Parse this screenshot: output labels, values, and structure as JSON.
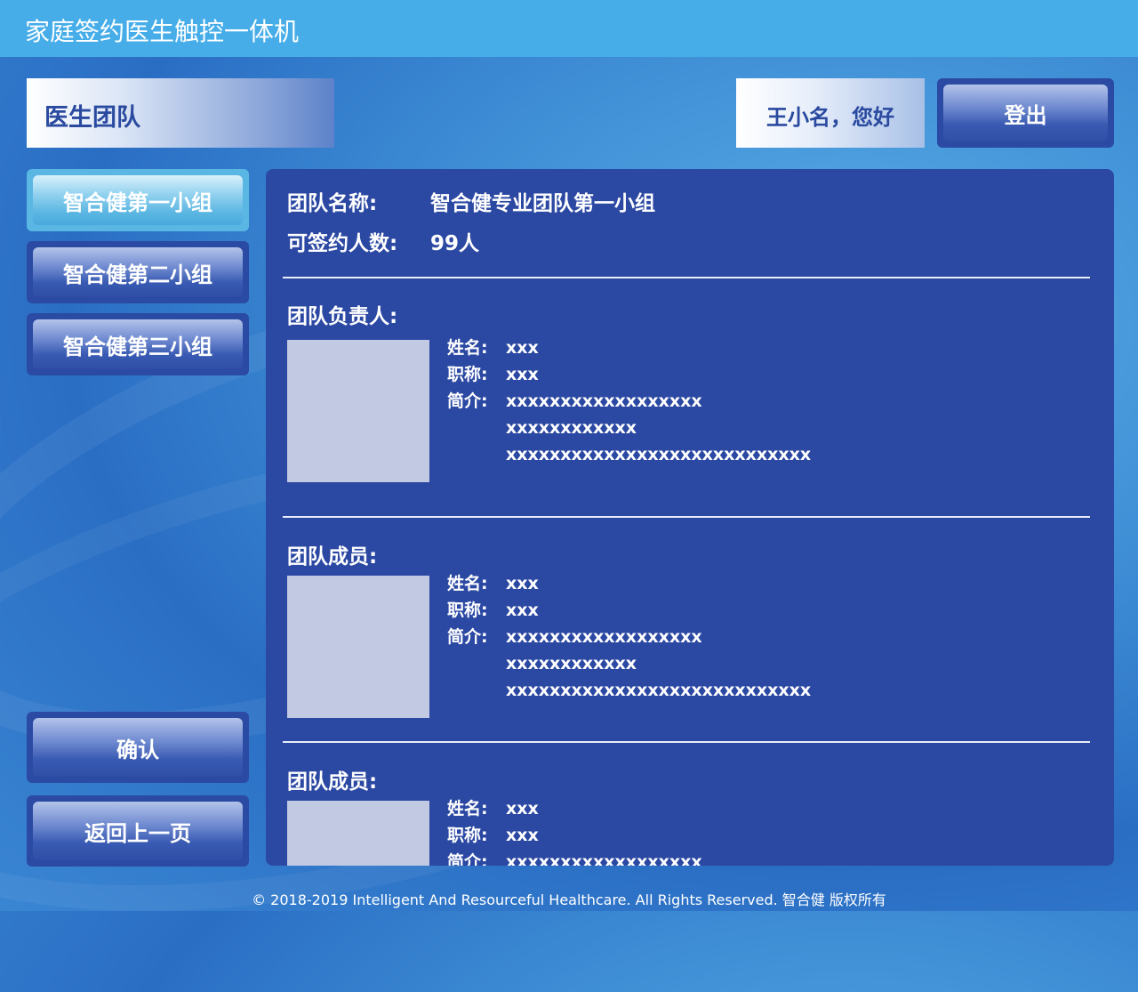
{
  "app": {
    "title": "家庭签约医生触控一体机"
  },
  "header": {
    "page_title": "医生团队",
    "greeting": "王小名，您好",
    "logout_label": "登出"
  },
  "sidebar": {
    "groups": [
      {
        "label": "智合健第一小组",
        "active": true
      },
      {
        "label": "智合健第二小组",
        "active": false
      },
      {
        "label": "智合健第三小组",
        "active": false
      }
    ],
    "confirm_label": "确认",
    "back_label": "返回上一页"
  },
  "team": {
    "name_label": "团队名称:",
    "name_value": "智合健专业团队第一小组",
    "capacity_label": "可签约人数:",
    "capacity_value": "99人",
    "leader_title": "团队负责人:",
    "member_title": "团队成员:",
    "field_name": "姓名:",
    "field_title": "职称:",
    "field_intro": "简介:",
    "people": [
      {
        "name": "xxx",
        "title": "xxx",
        "intro": [
          "xxxxxxxxxxxxxxxxxx",
          "xxxxxxxxxxxx",
          "xxxxxxxxxxxxxxxxxxxxxxxxxxxx"
        ]
      },
      {
        "name": "xxx",
        "title": "xxx",
        "intro": [
          "xxxxxxxxxxxxxxxxxx",
          "xxxxxxxxxxxx",
          "xxxxxxxxxxxxxxxxxxxxxxxxxxxx"
        ]
      },
      {
        "name": "xxx",
        "title": "xxx",
        "intro": [
          "xxxxxxxxxxxxxxxxxx"
        ]
      }
    ]
  },
  "footer": {
    "copyright": "© 2018-2019 Intelligent And Resourceful Healthcare. All Rights Reserved. 智合健 版权所有"
  },
  "colors": {
    "topbar": "#46ade9",
    "panel": "#2b48a3",
    "accent_text": "#2a4aa0"
  }
}
